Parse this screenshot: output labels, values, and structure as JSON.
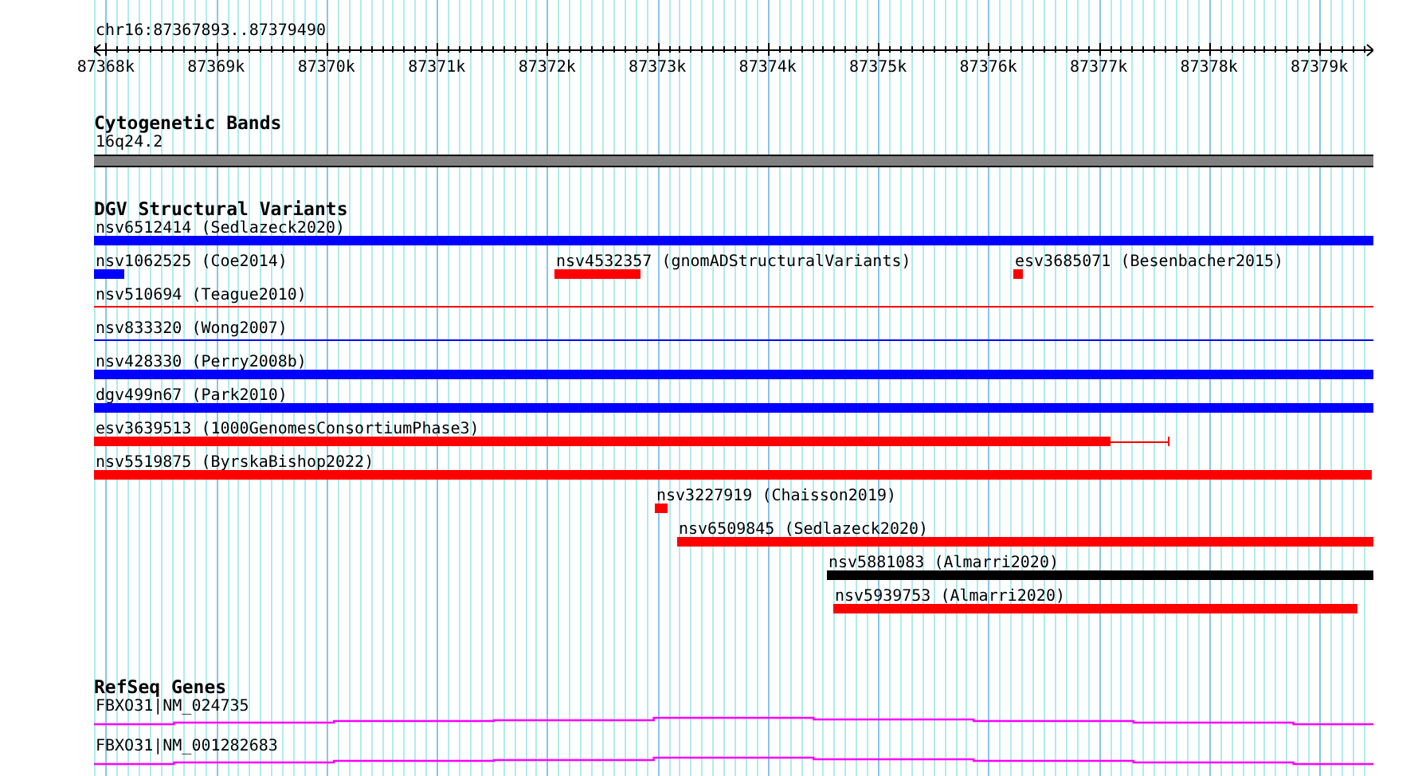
{
  "ruler": {
    "location": "chr16:87367893..87379490",
    "ticks": [
      "87368k",
      "87369k",
      "87370k",
      "87371k",
      "87372k",
      "87373k",
      "87374k",
      "87375k",
      "87376k",
      "87377k",
      "87378k",
      "87379k"
    ]
  },
  "tracks": [
    {
      "kind": "bands",
      "title": "Cytogenetic Bands",
      "rows": [
        {
          "features": [
            {
              "label": "16q24.2"
            }
          ]
        }
      ]
    },
    {
      "kind": "variants",
      "title": "DGV Structural Variants",
      "rows": [
        {
          "features": [
            {
              "label": "nsv6512414 (Sedlazeck2020)",
              "color": "#0000ff",
              "kind": "thick"
            }
          ]
        },
        {
          "features": [
            {
              "label": "nsv1062525 (Coe2014)",
              "color": "#0000ff",
              "kind": "thick"
            },
            {
              "label": "nsv4532357 (gnomADStructuralVariants)",
              "color": "#ff0000",
              "kind": "thick"
            },
            {
              "label": "esv3685071 (Besenbacher2015)",
              "color": "#ff0000",
              "kind": "thick"
            }
          ]
        },
        {
          "features": [
            {
              "label": "nsv510694 (Teague2010)",
              "color": "#ff0000",
              "kind": "thin"
            }
          ]
        },
        {
          "features": [
            {
              "label": "nsv833320 (Wong2007)",
              "color": "#0000ff",
              "kind": "thin"
            }
          ]
        },
        {
          "features": [
            {
              "label": "nsv428330 (Perry2008b)",
              "color": "#0000ff",
              "kind": "thick"
            }
          ]
        },
        {
          "features": [
            {
              "label": "dgv499n67 (Park2010)",
              "color": "#0000ff",
              "kind": "thick"
            }
          ]
        },
        {
          "features": [
            {
              "label": "esv3639513 (1000GenomesConsortiumPhase3)",
              "color": "#ff0000",
              "kind": "tailed"
            }
          ]
        },
        {
          "features": [
            {
              "label": "nsv5519875 (ByrskaBishop2022)",
              "color": "#ff0000",
              "kind": "thick"
            }
          ]
        },
        {
          "features": [
            {
              "label": "nsv3227919 (Chaisson2019)",
              "color": "#ff0000",
              "kind": "thick"
            }
          ]
        },
        {
          "features": [
            {
              "label": "nsv6509845 (Sedlazeck2020)",
              "color": "#ff0000",
              "kind": "thick"
            }
          ]
        },
        {
          "features": [
            {
              "label": "nsv5881083 (Almarri2020)",
              "color": "#000000",
              "kind": "thick"
            }
          ]
        },
        {
          "features": [
            {
              "label": "nsv5939753 (Almarri2020)",
              "color": "#ff0000",
              "kind": "thick"
            }
          ]
        }
      ]
    },
    {
      "kind": "genes",
      "title": "RefSeq Genes",
      "rows": [
        {
          "features": [
            {
              "label": "FBXO31|NM_024735"
            }
          ]
        },
        {
          "features": [
            {
              "label": "FBXO31|NM_001282683"
            }
          ]
        }
      ]
    }
  ]
}
